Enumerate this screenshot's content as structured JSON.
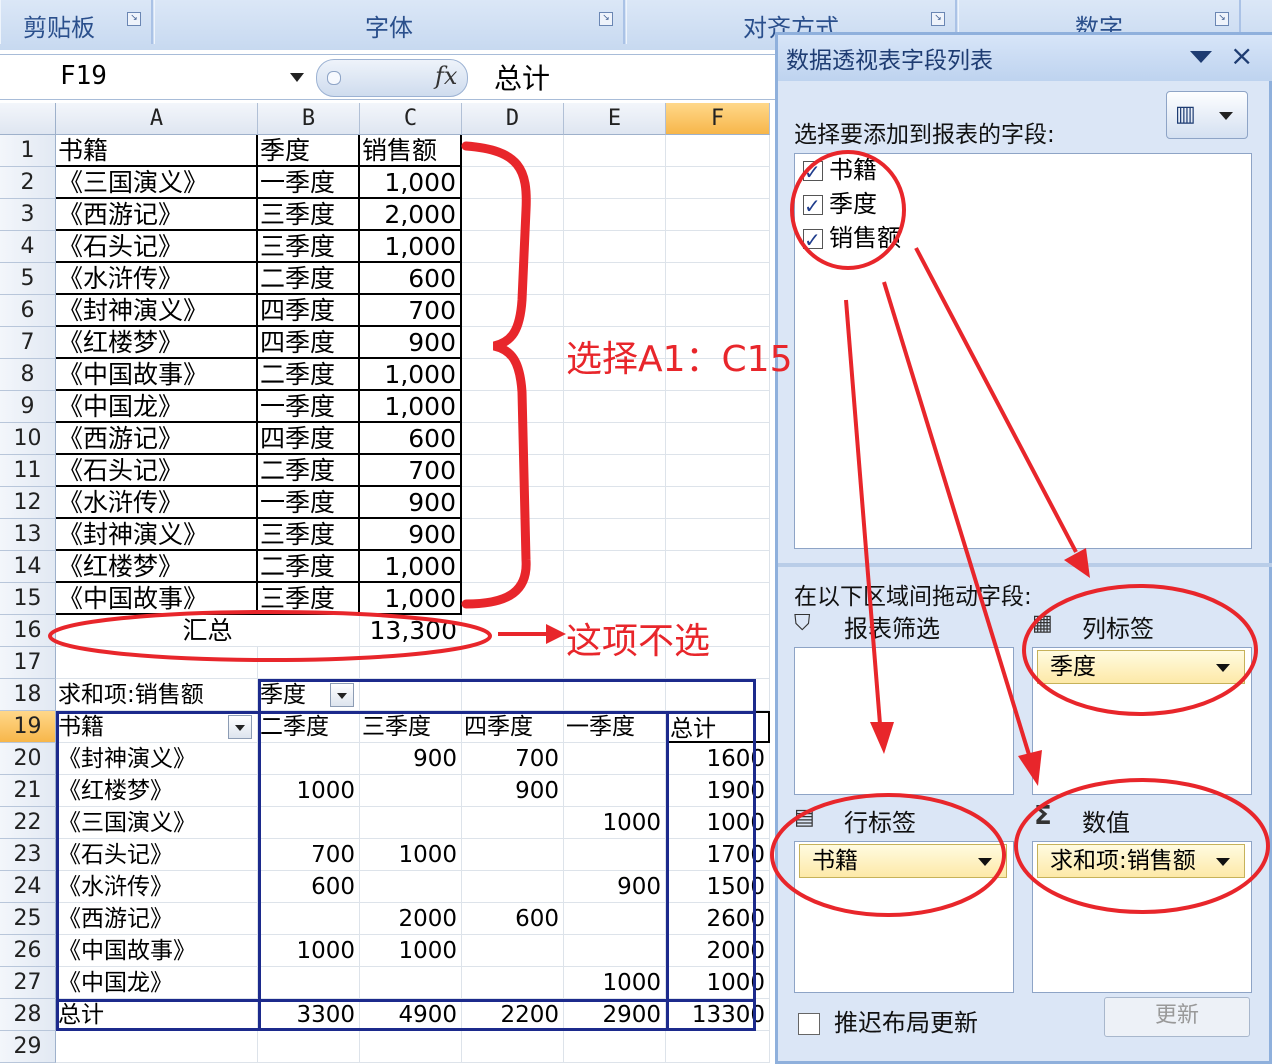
{
  "ribbon": {
    "groups": [
      "剪贴板",
      "字体",
      "对齐方式",
      "数字"
    ]
  },
  "formula_bar": {
    "name_box": "F19",
    "fx": "fx",
    "formula": "总计"
  },
  "columns": [
    "A",
    "B",
    "C",
    "D",
    "E",
    "F"
  ],
  "rows": [
    "1",
    "2",
    "3",
    "4",
    "5",
    "6",
    "7",
    "8",
    "9",
    "10",
    "11",
    "12",
    "13",
    "14",
    "15",
    "16",
    "17",
    "18",
    "19",
    "20",
    "21",
    "22",
    "23",
    "24",
    "25",
    "26",
    "27",
    "28",
    "29"
  ],
  "source_table": {
    "headers": [
      "书籍",
      "季度",
      "销售额"
    ],
    "rows": [
      [
        "《三国演义》",
        "一季度",
        "1,000"
      ],
      [
        "《西游记》",
        "三季度",
        "2,000"
      ],
      [
        "《石头记》",
        "三季度",
        "1,000"
      ],
      [
        "《水浒传》",
        "二季度",
        "600"
      ],
      [
        "《封神演义》",
        "四季度",
        "700"
      ],
      [
        "《红楼梦》",
        "四季度",
        "900"
      ],
      [
        "《中国故事》",
        "二季度",
        "1,000"
      ],
      [
        "《中国龙》",
        "一季度",
        "1,000"
      ],
      [
        "《西游记》",
        "四季度",
        "600"
      ],
      [
        "《石头记》",
        "二季度",
        "700"
      ],
      [
        "《水浒传》",
        "一季度",
        "900"
      ],
      [
        "《封神演义》",
        "三季度",
        "900"
      ],
      [
        "《红楼梦》",
        "二季度",
        "1,000"
      ],
      [
        "《中国故事》",
        "三季度",
        "1,000"
      ]
    ],
    "total_label": "汇总",
    "total_value": "13,300"
  },
  "pivot": {
    "corner_label": "求和项:销售额",
    "col_field": "季度",
    "row_field": "书籍",
    "col_headers": [
      "二季度",
      "三季度",
      "四季度",
      "一季度",
      "总计"
    ],
    "rows": [
      {
        "label": "《封神演义》",
        "values": [
          "",
          "900",
          "700",
          "",
          "1600"
        ]
      },
      {
        "label": "《红楼梦》",
        "values": [
          "1000",
          "",
          "900",
          "",
          "1900"
        ]
      },
      {
        "label": "《三国演义》",
        "values": [
          "",
          "",
          "",
          "1000",
          "1000"
        ]
      },
      {
        "label": "《石头记》",
        "values": [
          "700",
          "1000",
          "",
          "",
          "1700"
        ]
      },
      {
        "label": "《水浒传》",
        "values": [
          "600",
          "",
          "",
          "900",
          "1500"
        ]
      },
      {
        "label": "《西游记》",
        "values": [
          "",
          "2000",
          "600",
          "",
          "2600"
        ]
      },
      {
        "label": "《中国故事》",
        "values": [
          "1000",
          "1000",
          "",
          "",
          "2000"
        ]
      },
      {
        "label": "《中国龙》",
        "values": [
          "",
          "",
          "",
          "1000",
          "1000"
        ]
      }
    ],
    "total_label": "总计",
    "totals": [
      "3300",
      "4900",
      "2200",
      "2900",
      "13300"
    ]
  },
  "field_panel": {
    "title": "数据透视表字段列表",
    "close": "×",
    "choose_label": "选择要添加到报表的字段:",
    "fields": [
      "书籍",
      "季度",
      "销售额"
    ],
    "drag_label": "在以下区域间拖动字段:",
    "areas": {
      "filter": {
        "title": "报表筛选",
        "icon": "filter-icon"
      },
      "columns": {
        "title": "列标签",
        "icon": "column-labels-icon",
        "chip": "季度"
      },
      "rows": {
        "title": "行标签",
        "icon": "row-labels-icon",
        "chip": "书籍"
      },
      "values": {
        "title": "数值",
        "icon": "sigma-icon",
        "sigma": "Σ",
        "chip": "求和项:销售额"
      }
    },
    "defer_label": "推迟布局更新",
    "update_label": "更新"
  },
  "annotations": {
    "select_range": "选择A1：C15",
    "exclude_item": "这项不选",
    "color": "#e8262b"
  }
}
